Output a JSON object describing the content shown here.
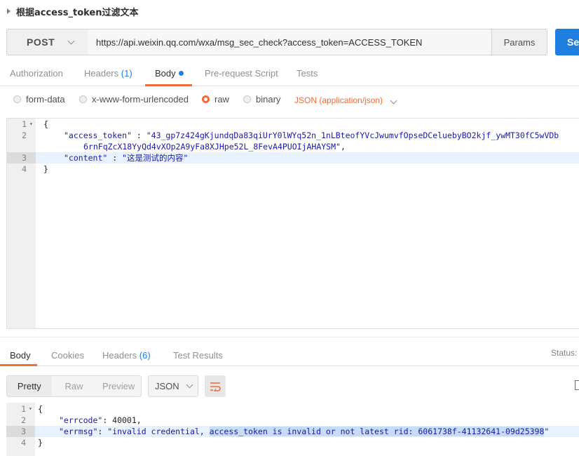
{
  "request_title": "根据access_token过滤文本",
  "method": "POST",
  "url": "https://api.weixin.qq.com/wxa/msg_sec_check?access_token=ACCESS_TOKEN",
  "params_label": "Params",
  "send_label": "Se",
  "request_tabs": [
    {
      "label": "Authorization"
    },
    {
      "label": "Headers",
      "count": "(1)"
    },
    {
      "label": "Body",
      "active": true,
      "has_dot": true
    },
    {
      "label": "Pre-request Script"
    },
    {
      "label": "Tests"
    }
  ],
  "body_modes": [
    {
      "label": "form-data",
      "selected": false
    },
    {
      "label": "x-www-form-urlencoded",
      "selected": false
    },
    {
      "label": "raw",
      "selected": true
    },
    {
      "label": "binary",
      "selected": false
    }
  ],
  "content_type": "JSON (application/json)",
  "request_body": {
    "line_numbers": [
      "1",
      "2",
      "",
      "3",
      "4"
    ],
    "l1": "{",
    "l2_key": "\"access_token\"",
    "l2_sep": " : ",
    "l2_val": "\"43_gp7z424gKjundqDa83qiUrY0lWYq52n_1nLBteofYVcJwumvfOpseDCeluebyBO2kjf_ywMT30fC5wVDb",
    "l2_cont": "6rnFqZcX18YyQd4vXOp2A9yFa8XJHpe52L_8FevA4PUOIjAHAYSM\"",
    "l2_comma": ",",
    "l3_key": "\"content\"",
    "l3_sep": " : ",
    "l3_val": "\"这是测试的内容\"",
    "l4": "}"
  },
  "response_tabs": [
    {
      "label": "Body",
      "active": true
    },
    {
      "label": "Cookies"
    },
    {
      "label": "Headers",
      "count": "(6)"
    },
    {
      "label": "Test Results"
    }
  ],
  "status_label": "Status:",
  "format_buttons": [
    {
      "label": "Pretty",
      "active": true
    },
    {
      "label": "Raw"
    },
    {
      "label": "Preview"
    }
  ],
  "format_select": "JSON",
  "response_body": {
    "line_numbers": [
      "1",
      "2",
      "3",
      "4"
    ],
    "l1": "{",
    "l2_key": "\"errcode\"",
    "l2_rest": ": 40001,",
    "l3_key": "\"errmsg\"",
    "l3_sep": ": ",
    "l3_val_a": "\"invalid credential, ",
    "l3_val_sel": "access_token is invalid or not latest rid: 6061738f-41132641-09d25398",
    "l3_val_end": "\"",
    "l4": "}"
  },
  "icons": [
    "caret-right-icon",
    "chevron-down-icon",
    "wrap-lines-icon",
    "copy-icon"
  ],
  "colors": {
    "accent": "#f26b3a",
    "primary": "#1e7fe0",
    "string": "#1a1aa6"
  }
}
